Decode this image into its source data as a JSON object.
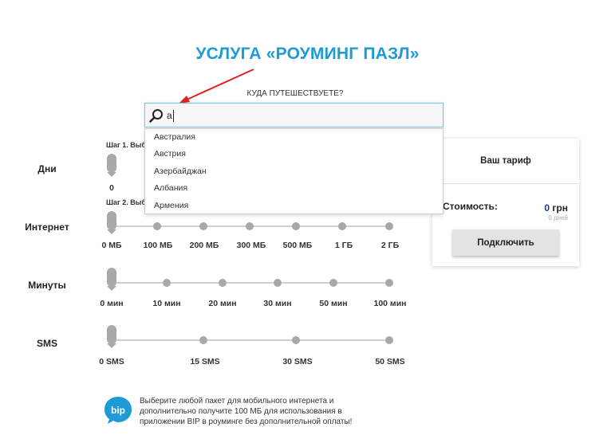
{
  "page_title": "УСЛУГА «РОУМИНГ ПАЗЛ»",
  "search": {
    "question": "КУДА ПУТЕШЕСТВУЕТЕ?",
    "value": "а",
    "options": [
      "Австралия",
      "Австрия",
      "Азербайджан",
      "Албания",
      "Армения"
    ]
  },
  "rows": {
    "days": {
      "label": "Дни",
      "step": "Шаг 1. Выб",
      "ticks": [
        "0"
      ],
      "selected": "0"
    },
    "internet": {
      "label": "Интернет",
      "step": "Шаг 2. Выб",
      "ticks": [
        "0 МБ",
        "100 МБ",
        "200 МБ",
        "300 МБ",
        "500 МБ",
        "1 ГБ",
        "2 ГБ"
      ],
      "selected": "0 МБ"
    },
    "minutes": {
      "label": "Минуты",
      "ticks": [
        "0 мин",
        "10 мин",
        "20 мин",
        "30 мин",
        "50 мин",
        "100 мин"
      ],
      "selected": "0 мин"
    },
    "sms": {
      "label": "SMS",
      "ticks": [
        "0 SMS",
        "15 SMS",
        "30 SMS",
        "50 SMS"
      ],
      "selected": "0 SMS"
    }
  },
  "tariff": {
    "title": "Ваш тариф",
    "cost_label": "Стоимость:",
    "price_value": "0",
    "price_currency": "грн",
    "days": "0 дней",
    "connect_label": "Подключить"
  },
  "promo": {
    "logo_text": "bip",
    "text": "Выберите любой пакет для мобильного интернета и дополнительно получите 100 МБ для использования в приложении BIP в роуминге без дополнительной оплаты!"
  },
  "colors": {
    "accent": "#1e9bd7",
    "arrow": "#e02020",
    "slider": "#a9a9a9",
    "track": "#cfcfcf"
  }
}
